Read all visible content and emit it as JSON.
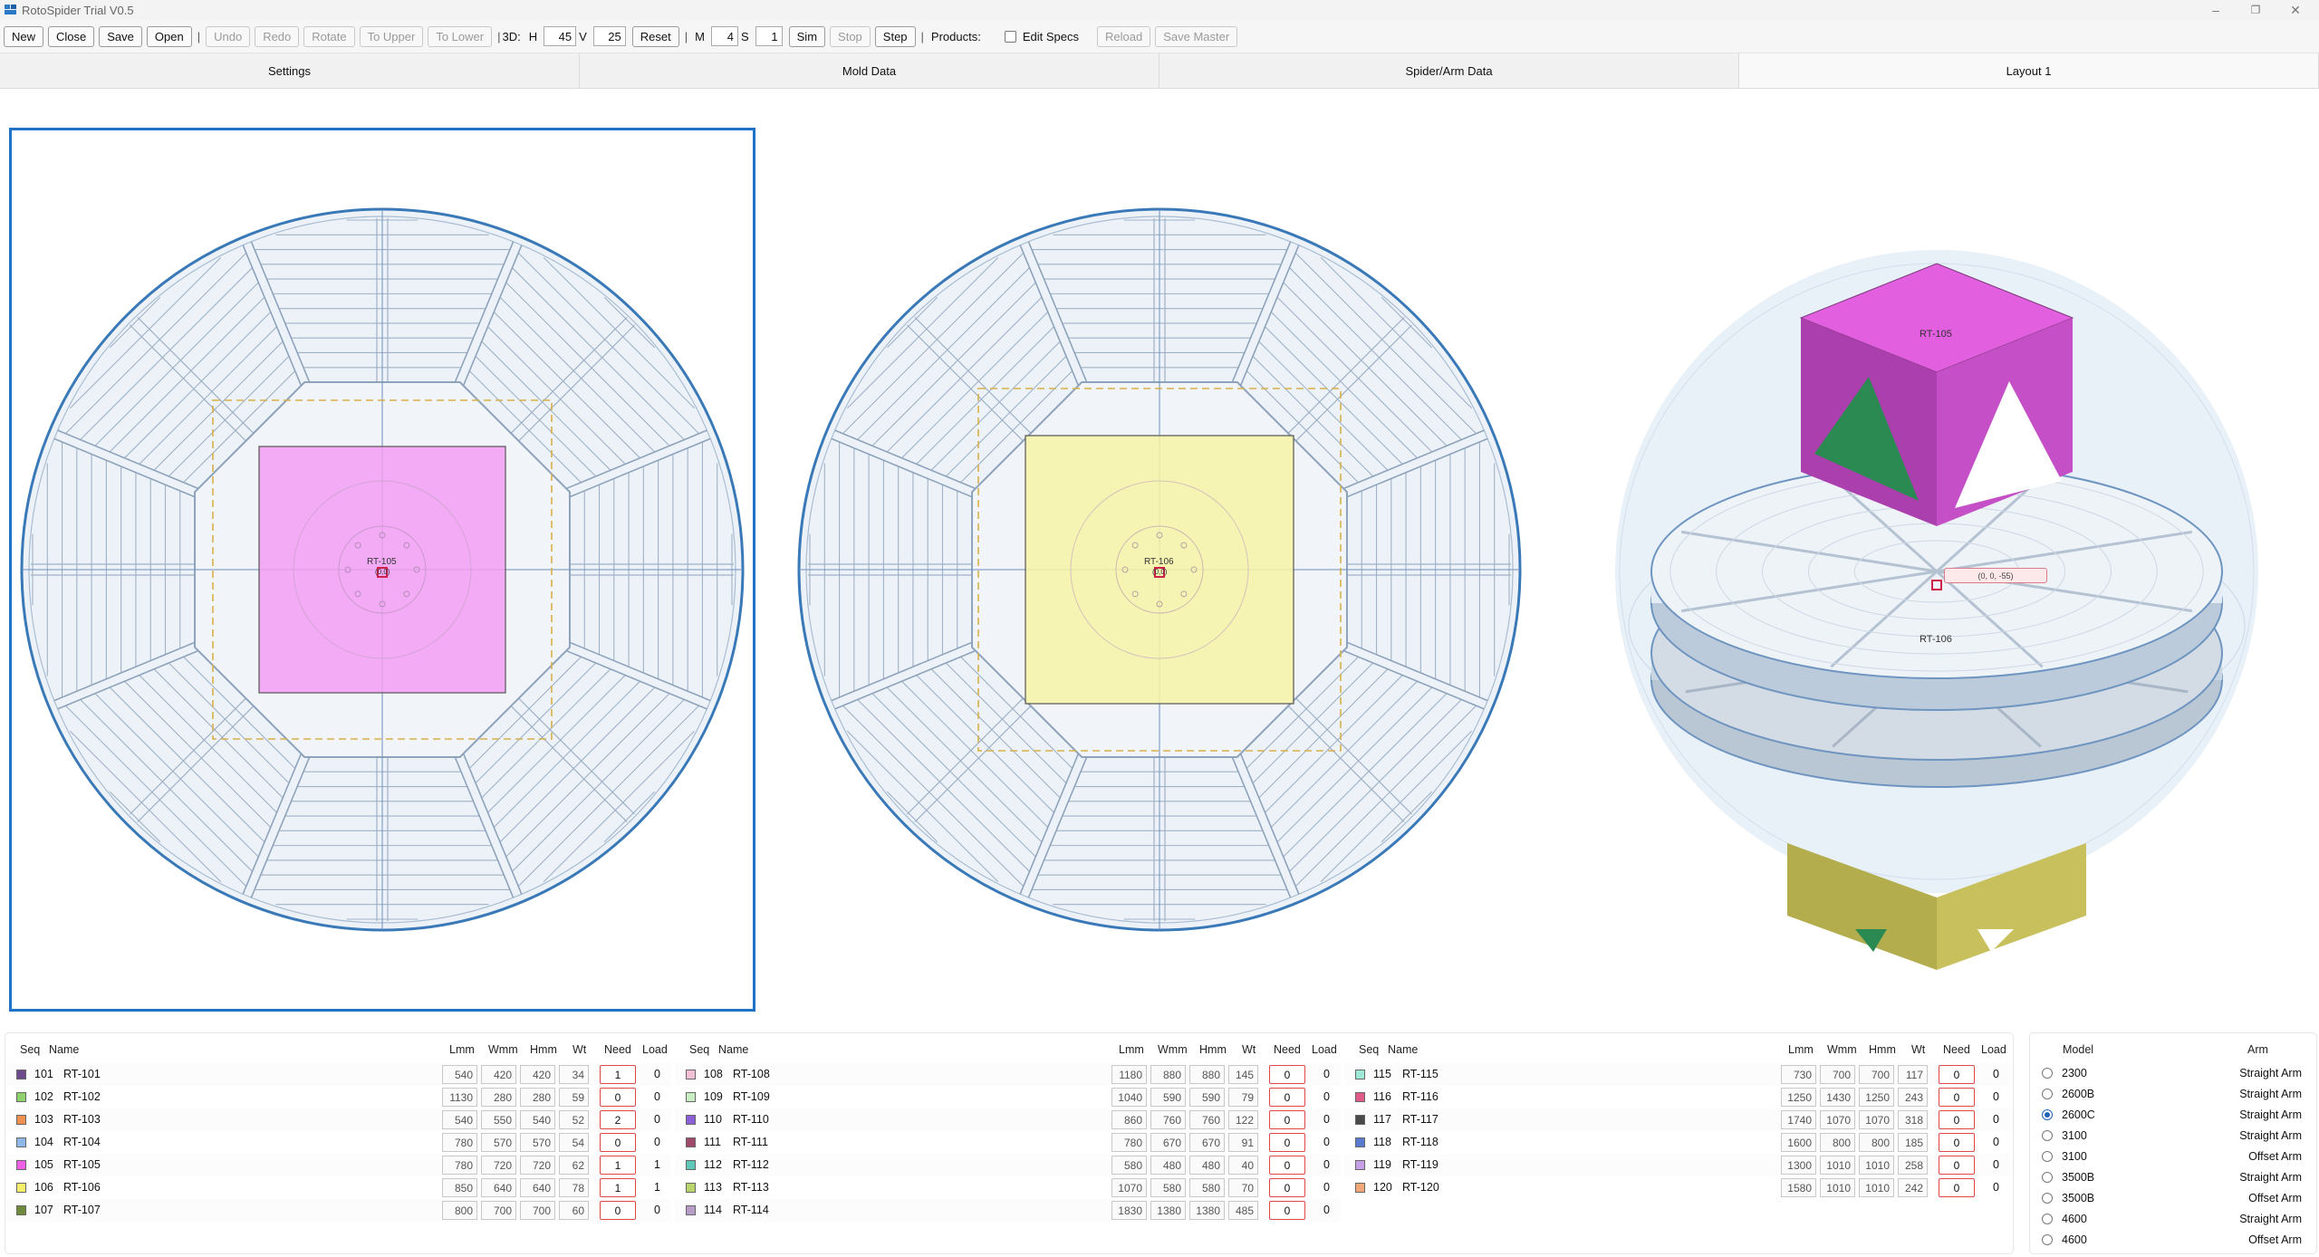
{
  "window": {
    "title": "RotoSpider Trial V0.5"
  },
  "toolbar": {
    "new": "New",
    "close": "Close",
    "save": "Save",
    "open": "Open",
    "undo": "Undo",
    "redo": "Redo",
    "rotate": "Rotate",
    "to_upper": "To Upper",
    "to_lower": "To Lower",
    "label_3d": "3D:",
    "label_h": "H",
    "h_value": "45",
    "label_v": "V",
    "v_value": "25",
    "reset": "Reset",
    "label_m": "M",
    "m_value": "4",
    "label_s": "S",
    "s_value": "1",
    "sim": "Sim",
    "stop": "Stop",
    "step": "Step",
    "products": "Products:",
    "edit_specs": "Edit Specs",
    "reload": "Reload",
    "save_master": "Save Master",
    "sep": "|"
  },
  "tabs": [
    "Settings",
    "Mold Data",
    "Spider/Arm Data",
    "Layout 1"
  ],
  "views": {
    "left": {
      "part_label": "RT-105",
      "coord": "(0,0)",
      "part_color": "#f29ef2"
    },
    "middle": {
      "part_label": "RT-106",
      "coord": "(0,0)",
      "part_color": "#f7f3a6"
    },
    "iso": {
      "upper_label": "RT-105",
      "lower_label": "RT-106",
      "coord_label": "(0, 0, -55)"
    }
  },
  "table_headers": {
    "seq": "Seq",
    "name": "Name",
    "l": "Lmm",
    "w": "Wmm",
    "h": "Hmm",
    "wt": "Wt",
    "need": "Need",
    "load": "Load"
  },
  "products": [
    [
      {
        "seq": "101",
        "name": "RT-101",
        "l": "540",
        "w": "420",
        "h": "420",
        "wt": "34",
        "need": "1",
        "load": "0",
        "color": "#6e4a8c"
      },
      {
        "seq": "102",
        "name": "RT-102",
        "l": "1130",
        "w": "280",
        "h": "280",
        "wt": "59",
        "need": "0",
        "load": "0",
        "color": "#8fd16a"
      },
      {
        "seq": "103",
        "name": "RT-103",
        "l": "540",
        "w": "550",
        "h": "540",
        "wt": "52",
        "need": "2",
        "load": "0",
        "color": "#f09050"
      },
      {
        "seq": "104",
        "name": "RT-104",
        "l": "780",
        "w": "570",
        "h": "570",
        "wt": "54",
        "need": "0",
        "load": "0",
        "color": "#8fb8e8"
      },
      {
        "seq": "105",
        "name": "RT-105",
        "l": "780",
        "w": "720",
        "h": "720",
        "wt": "62",
        "need": "1",
        "load": "1",
        "color": "#ee5fe6"
      },
      {
        "seq": "106",
        "name": "RT-106",
        "l": "850",
        "w": "640",
        "h": "640",
        "wt": "78",
        "need": "1",
        "load": "1",
        "color": "#f7f06a"
      },
      {
        "seq": "107",
        "name": "RT-107",
        "l": "800",
        "w": "700",
        "h": "700",
        "wt": "60",
        "need": "0",
        "load": "0",
        "color": "#6e8a3a"
      }
    ],
    [
      {
        "seq": "108",
        "name": "RT-108",
        "l": "1180",
        "w": "880",
        "h": "880",
        "wt": "145",
        "need": "0",
        "load": "0",
        "color": "#f2bfd6"
      },
      {
        "seq": "109",
        "name": "RT-109",
        "l": "1040",
        "w": "590",
        "h": "590",
        "wt": "79",
        "need": "0",
        "load": "0",
        "color": "#c9eec4"
      },
      {
        "seq": "110",
        "name": "RT-110",
        "l": "860",
        "w": "760",
        "h": "760",
        "wt": "122",
        "need": "0",
        "load": "0",
        "color": "#8b5fd6"
      },
      {
        "seq": "111",
        "name": "RT-111",
        "l": "780",
        "w": "670",
        "h": "670",
        "wt": "91",
        "need": "0",
        "load": "0",
        "color": "#a0496a"
      },
      {
        "seq": "112",
        "name": "RT-112",
        "l": "580",
        "w": "480",
        "h": "480",
        "wt": "40",
        "need": "0",
        "load": "0",
        "color": "#5fc8b8"
      },
      {
        "seq": "113",
        "name": "RT-113",
        "l": "1070",
        "w": "580",
        "h": "580",
        "wt": "70",
        "need": "0",
        "load": "0",
        "color": "#b8d46a"
      },
      {
        "seq": "114",
        "name": "RT-114",
        "l": "1830",
        "w": "1380",
        "h": "1380",
        "wt": "485",
        "need": "0",
        "load": "0",
        "color": "#b89cc8"
      }
    ],
    [
      {
        "seq": "115",
        "name": "RT-115",
        "l": "730",
        "w": "700",
        "h": "700",
        "wt": "117",
        "need": "0",
        "load": "0",
        "color": "#9ee8d8"
      },
      {
        "seq": "116",
        "name": "RT-116",
        "l": "1250",
        "w": "1430",
        "h": "1250",
        "wt": "243",
        "need": "0",
        "load": "0",
        "color": "#e05a8a"
      },
      {
        "seq": "117",
        "name": "RT-117",
        "l": "1740",
        "w": "1070",
        "h": "1070",
        "wt": "318",
        "need": "0",
        "load": "0",
        "color": "#4a4a4a"
      },
      {
        "seq": "118",
        "name": "RT-118",
        "l": "1600",
        "w": "800",
        "h": "800",
        "wt": "185",
        "need": "0",
        "load": "0",
        "color": "#5a7ad0"
      },
      {
        "seq": "119",
        "name": "RT-119",
        "l": "1300",
        "w": "1010",
        "h": "1010",
        "wt": "258",
        "need": "0",
        "load": "0",
        "color": "#c8a0e8"
      },
      {
        "seq": "120",
        "name": "RT-120",
        "l": "1580",
        "w": "1010",
        "h": "1010",
        "wt": "242",
        "need": "0",
        "load": "0",
        "color": "#f0a878"
      }
    ]
  ],
  "models": {
    "header_model": "Model",
    "header_arm": "Arm",
    "rows": [
      {
        "model": "2300",
        "arm": "Straight Arm",
        "selected": false
      },
      {
        "model": "2600B",
        "arm": "Straight Arm",
        "selected": false
      },
      {
        "model": "2600C",
        "arm": "Straight Arm",
        "selected": true
      },
      {
        "model": "3100",
        "arm": "Straight Arm",
        "selected": false
      },
      {
        "model": "3100",
        "arm": "Offset Arm",
        "selected": false
      },
      {
        "model": "3500B",
        "arm": "Straight Arm",
        "selected": false
      },
      {
        "model": "3500B",
        "arm": "Offset Arm",
        "selected": false
      },
      {
        "model": "4600",
        "arm": "Straight Arm",
        "selected": false
      },
      {
        "model": "4600",
        "arm": "Offset Arm",
        "selected": false
      }
    ]
  }
}
